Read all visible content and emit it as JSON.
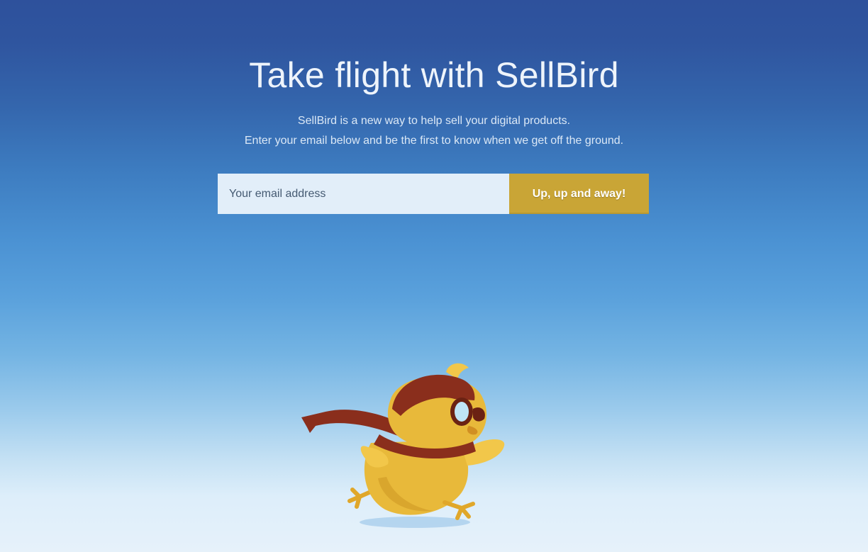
{
  "hero": {
    "title": "Take flight with SellBird",
    "subtitle_line1": "SellBird is a new way to help sell your digital products.",
    "subtitle_line2": "Enter your email below and be the first to know when we get off the ground."
  },
  "signup": {
    "email_placeholder": "Your email address",
    "email_value": "",
    "submit_label": "Up, up and away!"
  },
  "mascot": {
    "icon": "bird-mascot-icon"
  },
  "colors": {
    "sky_top": "#2e519c",
    "sky_bottom": "#e6f1fa",
    "button": "#c9a536",
    "input_bg": "#e2eef9",
    "bird_body": "#e8b93a",
    "bird_helmet": "#8a2e1c"
  }
}
